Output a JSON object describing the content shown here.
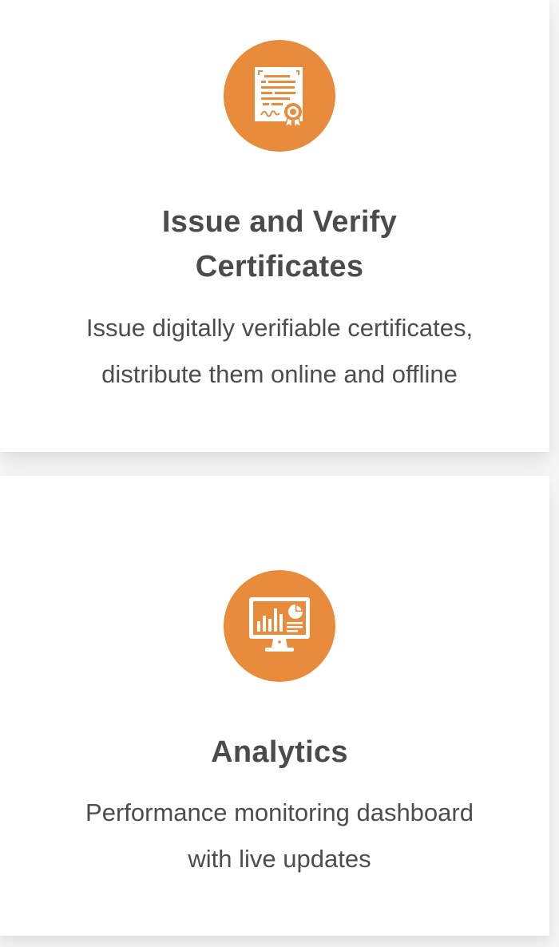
{
  "features": [
    {
      "icon": "certificate-icon",
      "title_line1": "Issue and Verify",
      "title_line2": "Certificates",
      "desc_line1": "Issue digitally verifiable certificates,",
      "desc_line2": "distribute them online and offline"
    },
    {
      "icon": "analytics-monitor-icon",
      "title_line1": "Analytics",
      "desc_line1": "Performance monitoring dashboard",
      "desc_line2": "with live updates"
    }
  ],
  "colors": {
    "accent": "#e88c3c",
    "text": "#4b4b4b",
    "card_background": "#ffffff"
  }
}
